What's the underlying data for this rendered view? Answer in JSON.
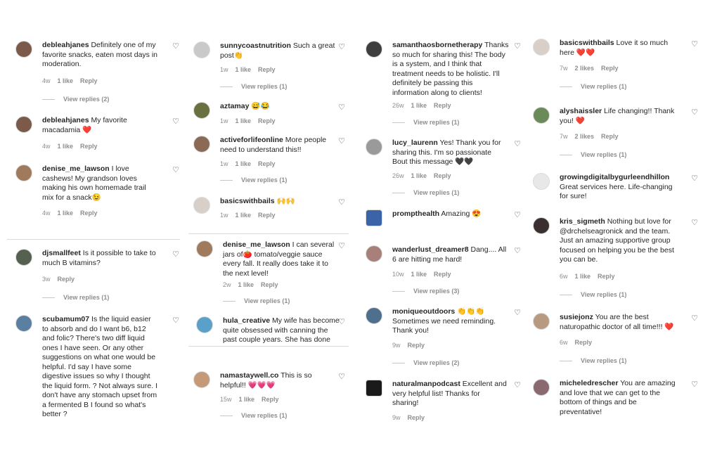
{
  "colors": {
    "text": "#262626",
    "muted": "#8e8e8e",
    "heart_red": "#e0245e",
    "background": "#ffffff"
  },
  "icons": {
    "like": "heart-outline-icon",
    "like_glyph": "♡"
  },
  "columns": [
    {
      "comments": [
        {
          "user": "debleahjanes",
          "text": " Definitely one of my\nfavorite snacks, eaten most days in\nmoderation.",
          "time": "4w",
          "likes": "1 like",
          "reply": "Reply",
          "view_replies": "View replies (2)",
          "avatar_color": "#7b5a4a"
        },
        {
          "user": "debleahjanes",
          "text": " My favorite\nmacadamia ❤️",
          "time": "4w",
          "likes": "1 like",
          "reply": "Reply",
          "view_replies": "",
          "avatar_color": "#7b5a4a"
        },
        {
          "user": "denise_me_lawson",
          "text": " I love\ncashews! My grandson loves\nmaking his own homemade trail\nmix for a snack😉",
          "time": "4w",
          "likes": "1 like",
          "reply": "Reply",
          "view_replies": "",
          "avatar_color": "#a07a5c"
        },
        {
          "user": "djsmallfeet",
          "text": " Is it possible to take to\nmuch B vitamins?",
          "time": "3w",
          "likes": "",
          "reply": "Reply",
          "view_replies": "View replies (1)",
          "avatar_color": "#55604f"
        },
        {
          "user": "scubamum07",
          "text": " Is the liquid easier\nto absorb and do I want b6, b12\nand folic? There's two diff liquid\nones I have seen. Or any other\nsuggestions on what one would be\nhelpful. I'd say I have some\ndigestive issues so why I thought\nthe liquid form. ? Not always sure. I\ndon't have any stomach upset from\na fermented B I found so what's\nbetter ?",
          "time": "",
          "likes": "",
          "reply": "",
          "view_replies": "",
          "avatar_color": "#5a7fa0"
        }
      ]
    },
    {
      "comments": [
        {
          "user": "sunnycoastnutrition",
          "text": " Such a great\npost👏",
          "time": "1w",
          "likes": "1 like",
          "reply": "Reply",
          "view_replies": "View replies (1)",
          "avatar_color": "#c9c9c9"
        },
        {
          "user": "aztamay",
          "text": " 😅😂",
          "time": "1w",
          "likes": "1 like",
          "reply": "Reply",
          "view_replies": "",
          "avatar_color": "#6b7040"
        },
        {
          "user": "activeforlifeonline",
          "text": " More people\nneed to understand this!!",
          "time": "1w",
          "likes": "1 like",
          "reply": "Reply",
          "view_replies": "View replies (1)",
          "avatar_color": "#8a6a55"
        },
        {
          "user": "basicswithbails",
          "text": " 🙌🙌",
          "time": "1w",
          "likes": "1 like",
          "reply": "Reply",
          "view_replies": "",
          "avatar_color": "#d8d0c8"
        },
        {
          "user": "denise_me_lawson",
          "text": " I can several\njars of🍅 tomato/veggie sauce\nevery fall. It really does take it to\nthe next level!",
          "time": "2w",
          "likes": "1 like",
          "reply": "Reply",
          "view_replies": "View replies (1)",
          "avatar_color": "#a07a5c"
        },
        {
          "user": "hula_creative",
          "text": " My wife has become\nquite obsessed with canning the\npast couple years. She has done",
          "time": "",
          "likes": "",
          "reply": "",
          "view_replies": "",
          "avatar_color": "#5aa0c8"
        },
        {
          "user": "namastaywell.co",
          "text": " This is so\nhelpful!! 💗💗💗",
          "time": "15w",
          "likes": "1 like",
          "reply": "Reply",
          "view_replies": "View replies (1)",
          "avatar_color": "#c49a78"
        }
      ]
    },
    {
      "comments": [
        {
          "user": "samanthaosbornetherapy",
          "text": " Thanks\nso much for sharing this! The body\nis a system, and I think that\ntreatment needs to be holistic. I'll\ndefinitely be passing this\ninformation along to clients!",
          "time": "26w",
          "likes": "1 like",
          "reply": "Reply",
          "view_replies": "View replies (1)",
          "avatar_color": "#3f3f3f"
        },
        {
          "user": "lucy_laurenn",
          "text": " Yes! Thank you for\nsharing this. I'm so passionate\nBout this message 🖤🖤",
          "time": "26w",
          "likes": "1 like",
          "reply": "Reply",
          "view_replies": "View replies (1)",
          "avatar_color": "#9a9a9a"
        },
        {
          "user": "prompthealth",
          "text": " Amazing 😍",
          "time": "",
          "likes": "",
          "reply": "",
          "view_replies": "",
          "avatar_color": "#3a63a8"
        },
        {
          "user": "wanderlust_dreamer8",
          "text": " Dang.... All\n6 are hitting me hard!",
          "time": "10w",
          "likes": "1 like",
          "reply": "Reply",
          "view_replies": "View replies (3)",
          "avatar_color": "#a8807a"
        },
        {
          "user": "moniqueoutdoors",
          "text": " 👏👏👏\nSometimes we need reminding.\nThank you!",
          "time": "9w",
          "likes": "",
          "reply": "Reply",
          "view_replies": "View replies (2)",
          "avatar_color": "#4f6f8f"
        },
        {
          "user": "naturalmanpodcast",
          "text": " Excellent and\nvery helpful list! Thanks for\nsharing!",
          "time": "9w",
          "likes": "",
          "reply": "Reply",
          "view_replies": "",
          "avatar_color": "#1a1a1a"
        }
      ]
    },
    {
      "comments": [
        {
          "user": "basicswithbails",
          "text": " Love it so much\nhere ❤️❤️",
          "time": "7w",
          "likes": "2 likes",
          "reply": "Reply",
          "view_replies": "View replies (1)",
          "avatar_color": "#d8d0c8"
        },
        {
          "user": "alyshaissler",
          "text": " Life changing!! Thank\nyou! ❤️",
          "time": "7w",
          "likes": "2 likes",
          "reply": "Reply",
          "view_replies": "View replies (1)",
          "avatar_color": "#6a8a5a"
        },
        {
          "user": "growingdigitalbygurleendhillon",
          "text": "\nGreat services here. Life-changing\nfor sure!",
          "time": "",
          "likes": "",
          "reply": "",
          "view_replies": "",
          "avatar_color": "#e8e8e8"
        },
        {
          "user": "kris_sigmeth",
          "text": " Nothing but love for\n@drchelseagronick and the team.\nJust an amazing supportive group\nfocused on helping you be the best\nyou can be.",
          "time": "6w",
          "likes": "1 like",
          "reply": "Reply",
          "view_replies": "View replies (1)",
          "avatar_color": "#3a3030"
        },
        {
          "user": "susiejonz",
          "text": " You are the best\nnaturopathic doctor of all time!!! ❤️",
          "time": "6w",
          "likes": "",
          "reply": "Reply",
          "view_replies": "View replies (1)",
          "avatar_color": "#b89a80"
        },
        {
          "user": "micheledrescher",
          "text": " You are amazing\nand love that we can get to the\nbottom of things and be\npreventative!",
          "time": "",
          "likes": "",
          "reply": "",
          "view_replies": "",
          "avatar_color": "#8a6a70"
        }
      ]
    }
  ]
}
